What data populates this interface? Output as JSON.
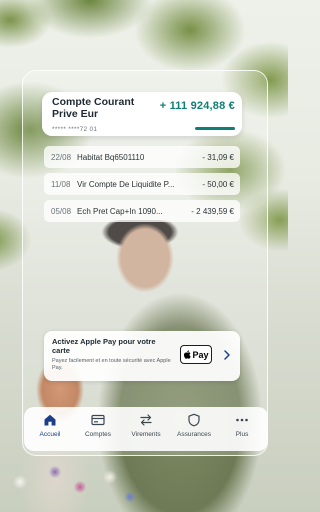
{
  "account": {
    "name": "Compte Courant Prive Eur",
    "balance": "+ 111 924,88 €",
    "number": "***** ****72 01"
  },
  "transactions": [
    {
      "date": "22/08",
      "label": "Habitat Bq6501110",
      "amount": "- 31,09 €"
    },
    {
      "date": "11/08",
      "label": "Vir Compte De Liquidite P...",
      "amount": "- 50,00 €"
    },
    {
      "date": "05/08",
      "label": "Ech Pret Cap+In 1090...",
      "amount": "- 2 439,59 €"
    }
  ],
  "apple_pay": {
    "title": "Activez Apple Pay pour votre carte",
    "description": "Payez facilement et en toute sécurité avec Apple Pay.",
    "badge": "Pay"
  },
  "nav": {
    "items": [
      {
        "label": "Accueil",
        "icon": "home-icon",
        "active": true
      },
      {
        "label": "Comptes",
        "icon": "card-icon",
        "active": false
      },
      {
        "label": "Virements",
        "icon": "transfer-icon",
        "active": false
      },
      {
        "label": "Assurances",
        "icon": "shield-icon",
        "active": false
      },
      {
        "label": "Plus",
        "icon": "more-icon",
        "active": false
      }
    ]
  },
  "colors": {
    "accent": "#0f7f73",
    "nav_active": "#1c3f8a"
  }
}
